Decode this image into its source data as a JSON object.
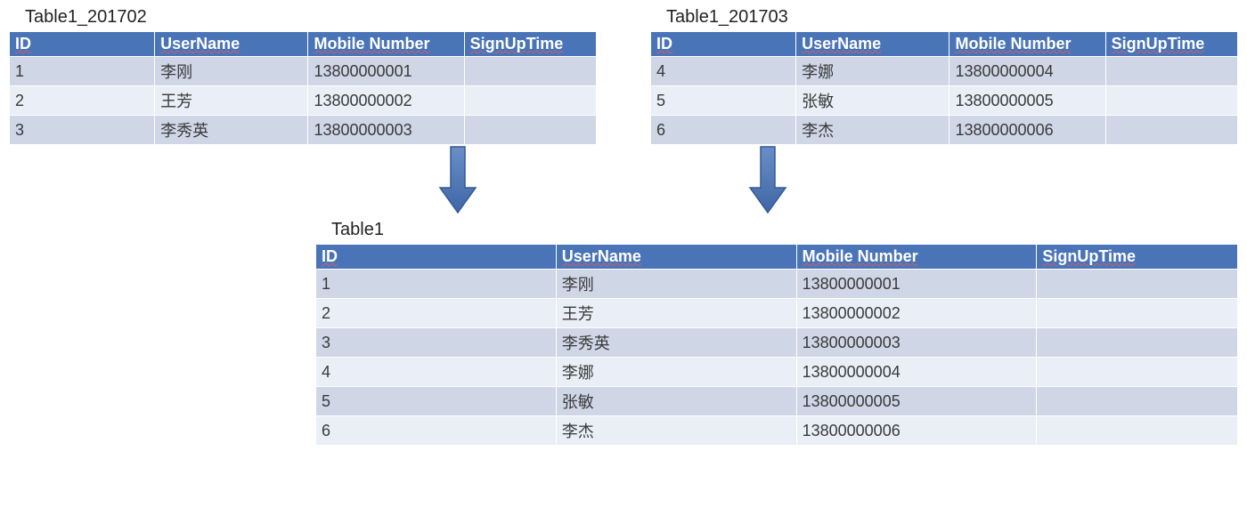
{
  "titles": {
    "t1": "Table1_201702",
    "t2": "Table1_201703",
    "t3": "Table1"
  },
  "headers": [
    "ID",
    "UserName",
    "Mobile Number",
    "SignUpTime"
  ],
  "tbl1": [
    {
      "id": "1",
      "user": "李刚",
      "mob": "13800000001",
      "sign": ""
    },
    {
      "id": "2",
      "user": "王芳",
      "mob": "13800000002",
      "sign": ""
    },
    {
      "id": "3",
      "user": "李秀英",
      "mob": "13800000003",
      "sign": ""
    }
  ],
  "tbl2": [
    {
      "id": "4",
      "user": "李娜",
      "mob": "13800000004",
      "sign": ""
    },
    {
      "id": "5",
      "user": "张敏",
      "mob": "13800000005",
      "sign": ""
    },
    {
      "id": "6",
      "user": "李杰",
      "mob": "13800000006",
      "sign": ""
    }
  ],
  "tbl3": [
    {
      "id": "1",
      "user": "李刚",
      "mob": "13800000001",
      "sign": ""
    },
    {
      "id": "2",
      "user": "王芳",
      "mob": "13800000002",
      "sign": ""
    },
    {
      "id": "3",
      "user": "李秀英",
      "mob": "13800000003",
      "sign": ""
    },
    {
      "id": "4",
      "user": "李娜",
      "mob": "13800000004",
      "sign": ""
    },
    {
      "id": "5",
      "user": "张敏",
      "mob": "13800000005",
      "sign": ""
    },
    {
      "id": "6",
      "user": "李杰",
      "mob": "13800000006",
      "sign": ""
    }
  ]
}
